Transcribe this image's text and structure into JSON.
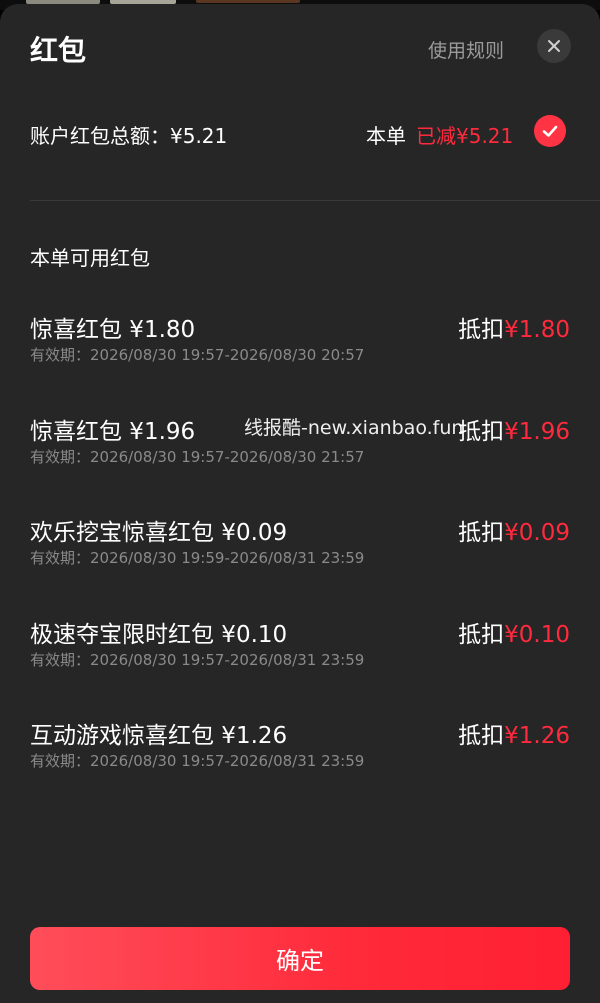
{
  "header": {
    "title": "红包",
    "rules_link": "使用规则"
  },
  "summary": {
    "total_label": "账户红包总额：¥5.21",
    "order_label": "本单",
    "reduced_text": "已减¥5.21",
    "selected": true
  },
  "section_label": "本单可用红包",
  "deduct_label": "抵扣",
  "validity_prefix": "有效期：",
  "items": [
    {
      "name": "惊喜红包 ¥1.80",
      "validity": "有效期：2026/08/30 19:57-2026/08/30 20:57",
      "deduct_amount": "¥1.80"
    },
    {
      "name": "惊喜红包 ¥1.96",
      "validity": "有效期：2026/08/30 19:57-2026/08/30 21:57",
      "deduct_amount": "¥1.96"
    },
    {
      "name": "欢乐挖宝惊喜红包 ¥0.09",
      "validity": "有效期：2026/08/30 19:59-2026/08/31 23:59",
      "deduct_amount": "¥0.09"
    },
    {
      "name": "极速夺宝限时红包 ¥0.10",
      "validity": "有效期：2026/08/30 19:57-2026/08/31 23:59",
      "deduct_amount": "¥0.10"
    },
    {
      "name": "互动游戏惊喜红包 ¥1.26",
      "validity": "有效期：2026/08/30 19:57-2026/08/31 23:59",
      "deduct_amount": "¥1.26"
    }
  ],
  "watermark": "线报酷-new.xianbao.fun",
  "confirm_label": "确定",
  "colors": {
    "sheet_bg": "#262626",
    "accent_red": "#ff2a3d",
    "muted_text": "#8a8a8a"
  }
}
